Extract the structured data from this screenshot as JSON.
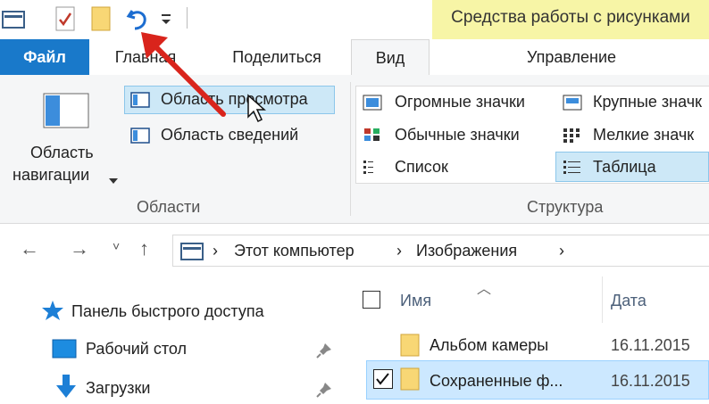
{
  "context_tab": {
    "title": "Средства работы с рисунками"
  },
  "tabs": [
    {
      "label": "Файл"
    },
    {
      "label": "Главная"
    },
    {
      "label": "Поделиться"
    },
    {
      "label": "Вид"
    },
    {
      "label": "Управление"
    }
  ],
  "ribbon": {
    "panes": {
      "nav_pane_label_line1": "Область",
      "nav_pane_label_line2": "навигации",
      "preview_pane": "Область просмотра",
      "details_pane": "Область сведений",
      "group_label": "Области"
    },
    "layout": {
      "extra_large_icons": "Огромные значки",
      "large_icons": "Крупные значк",
      "medium_icons": "Обычные значки",
      "small_icons": "Мелкие значк",
      "list": "Список",
      "details": "Таблица",
      "group_label": "Структура"
    }
  },
  "address": {
    "crumbs": [
      "Этот компьютер",
      "Изображения"
    ],
    "separator": "›"
  },
  "nav_pane": {
    "items": [
      {
        "label": "Панель быстрого доступа"
      },
      {
        "label": "Рабочий стол"
      },
      {
        "label": "Загрузки"
      }
    ]
  },
  "file_list": {
    "columns": {
      "name": "Имя",
      "date": "Дата"
    },
    "rows": [
      {
        "name": "Альбом камеры",
        "date": "16.11.2015",
        "selected": false
      },
      {
        "name": "Сохраненные ф...",
        "date": "16.11.2015",
        "selected": true
      }
    ]
  },
  "colors": {
    "file_tab": "#1979ca",
    "context_tab": "#f7f5a6",
    "selection": "#cce8ff",
    "annotation_arrow": "#d9241c"
  }
}
